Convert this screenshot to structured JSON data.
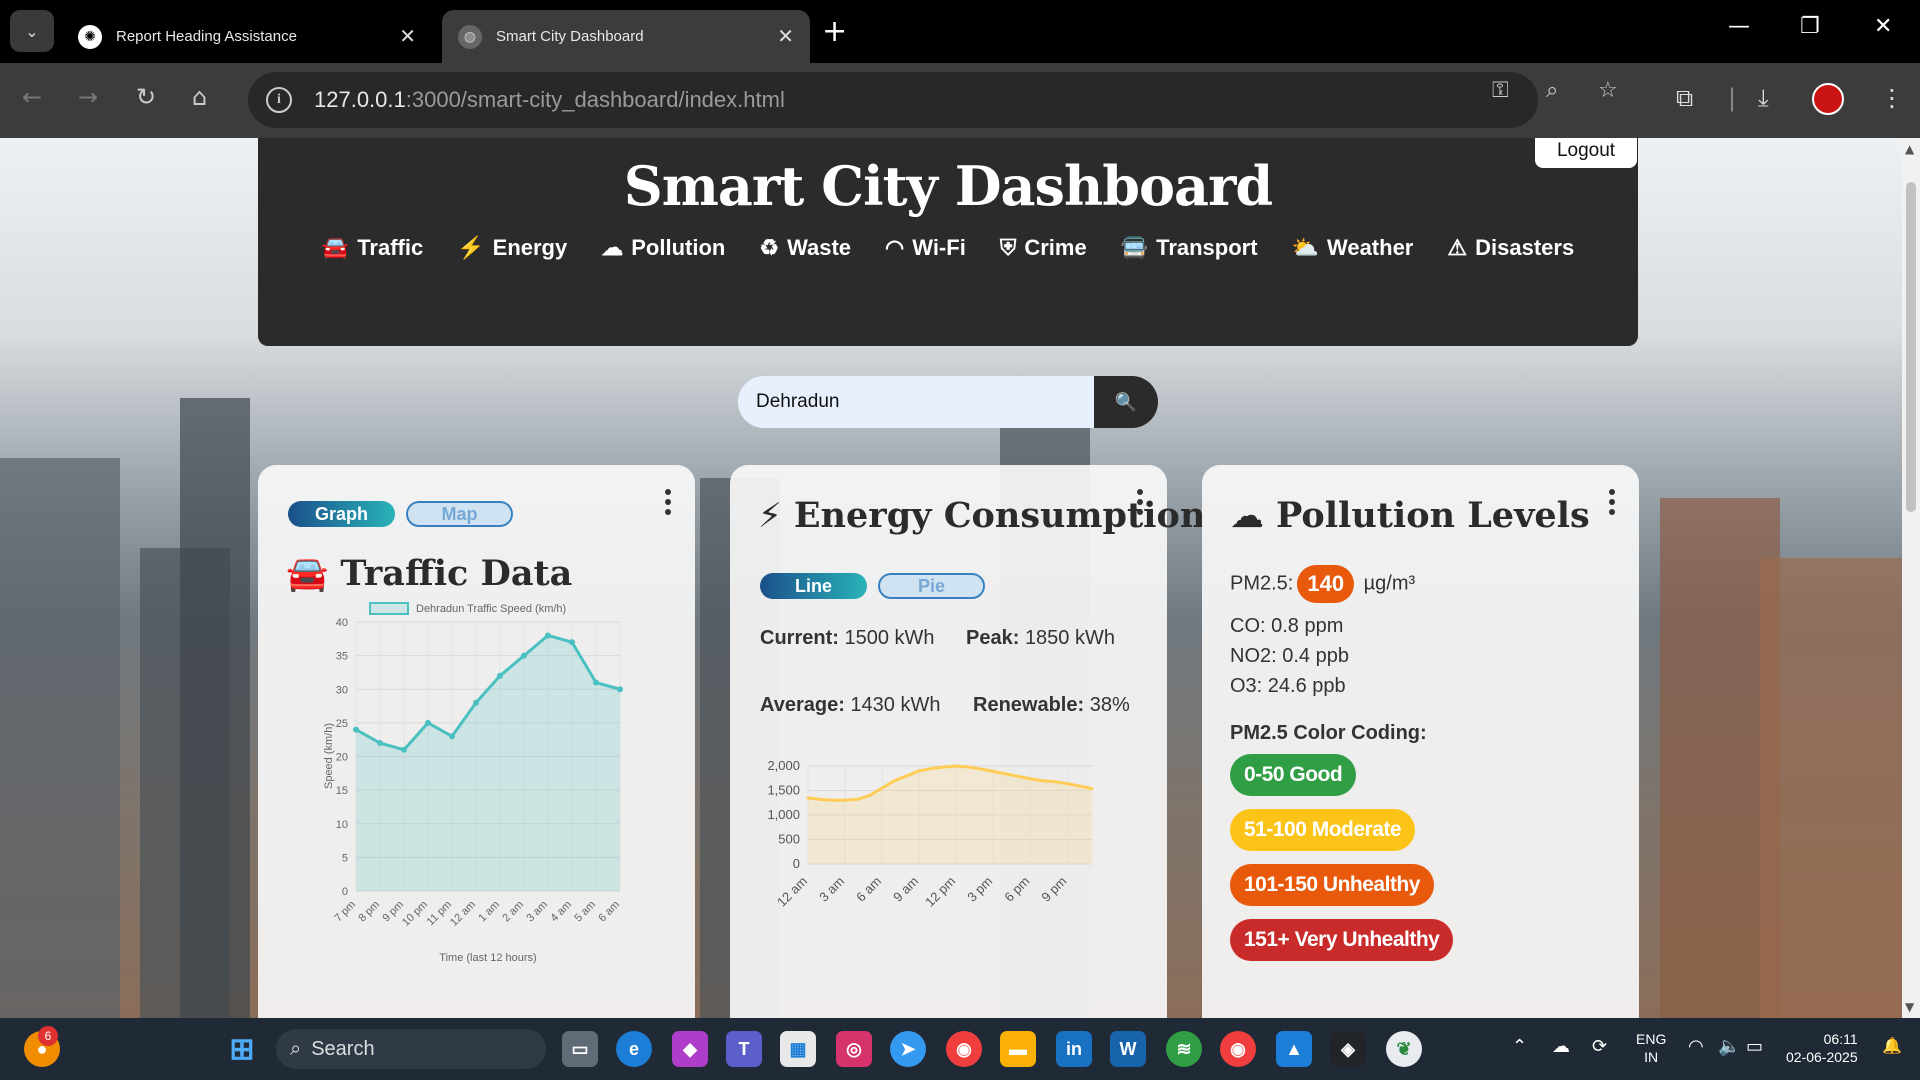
{
  "browser": {
    "tabs": [
      {
        "title": "Report Heading Assistance",
        "active": false
      },
      {
        "title": "Smart City Dashboard",
        "active": true
      }
    ],
    "url_host": "127.0.0.1",
    "url_rest": ":3000/smart-city_dashboard/index.html"
  },
  "header": {
    "title": "Smart City Dashboard",
    "logout": "Logout",
    "nav": [
      {
        "label": "Traffic",
        "icon": "car-icon"
      },
      {
        "label": "Energy",
        "icon": "bolt-icon"
      },
      {
        "label": "Pollution",
        "icon": "smog-icon"
      },
      {
        "label": "Waste",
        "icon": "recycle-icon"
      },
      {
        "label": "Wi-Fi",
        "icon": "wifi-icon"
      },
      {
        "label": "Crime",
        "icon": "shield-icon"
      },
      {
        "label": "Transport",
        "icon": "bus-icon"
      },
      {
        "label": "Weather",
        "icon": "cloud-sun-icon"
      },
      {
        "label": "Disasters",
        "icon": "warning-icon"
      }
    ]
  },
  "search": {
    "value": "Dehradun"
  },
  "traffic": {
    "toggle_graph": "Graph",
    "toggle_map": "Map",
    "title": "Traffic Data"
  },
  "energy": {
    "title": "Energy Consumption",
    "toggle_line": "Line",
    "toggle_pie": "Pie",
    "current_label": "Current:",
    "current_value": "1500 kWh",
    "peak_label": "Peak:",
    "peak_value": "1850 kWh",
    "average_label": "Average:",
    "average_value": "1430 kWh",
    "renewable_label": "Renewable:",
    "renewable_value": "38%"
  },
  "pollution": {
    "title": "Pollution Levels",
    "pm25_label": "PM2.5:",
    "pm25_value": "140",
    "pm25_unit": "µg/m³",
    "co": "CO: 0.8 ppm",
    "no2": "NO2: 0.4 ppb",
    "o3": "O3: 24.6 ppb",
    "coding_heading": "PM2.5 Color Coding:",
    "codes": [
      {
        "label": "0-50 Good",
        "color": "#2f9e44"
      },
      {
        "label": "51-100 Moderate",
        "color": "#fcc419"
      },
      {
        "label": "101-150 Unhealthy",
        "color": "#e8590c"
      },
      {
        "label": "151+ Very Unhealthy",
        "color": "#c92a2a"
      }
    ]
  },
  "chart_data": [
    {
      "type": "area",
      "series": [
        {
          "name": "Dehradun Traffic Speed (km/h)",
          "values": [
            24,
            22,
            21,
            25,
            23,
            28,
            32,
            35,
            38,
            37,
            31,
            30
          ]
        }
      ],
      "categories": [
        "7 pm",
        "8 pm",
        "9 pm",
        "10 pm",
        "11 pm",
        "12 am",
        "1 am",
        "2 am",
        "3 am",
        "4 am",
        "5 am",
        "6 am"
      ],
      "xlabel": "Time (last 12 hours)",
      "ylabel": "Speed (km/h)",
      "ylim": [
        0,
        40
      ],
      "yticks": [
        0,
        5,
        10,
        15,
        20,
        25,
        30,
        35,
        40
      ],
      "color": "#4bc0c0",
      "grid": true,
      "legend": "top"
    },
    {
      "type": "area",
      "x": [
        0,
        1,
        2,
        3,
        4,
        5,
        6,
        7,
        8,
        9,
        10,
        11,
        12,
        13,
        14,
        15,
        16,
        17,
        18,
        19,
        20,
        21,
        22,
        23
      ],
      "series": [
        {
          "values": [
            1350,
            1320,
            1300,
            1300,
            1320,
            1400,
            1550,
            1700,
            1800,
            1900,
            1950,
            1980,
            2000,
            1980,
            1940,
            1890,
            1840,
            1790,
            1740,
            1700,
            1680,
            1640,
            1590,
            1540
          ]
        }
      ],
      "tick_labels": [
        "12 am",
        "3 am",
        "6 am",
        "9 am",
        "12 pm",
        "3 pm",
        "6 pm",
        "9 pm"
      ],
      "ylim": [
        0,
        2000
      ],
      "yticks": [
        "0",
        "500",
        "1,000",
        "1,500",
        "2,000"
      ],
      "color": "#ffcd56",
      "grid": true
    }
  ],
  "taskbar": {
    "search": "Search",
    "lang": "ENG",
    "region": "IN",
    "time": "06:11",
    "date": "02-06-2025",
    "notif_count": "6"
  }
}
